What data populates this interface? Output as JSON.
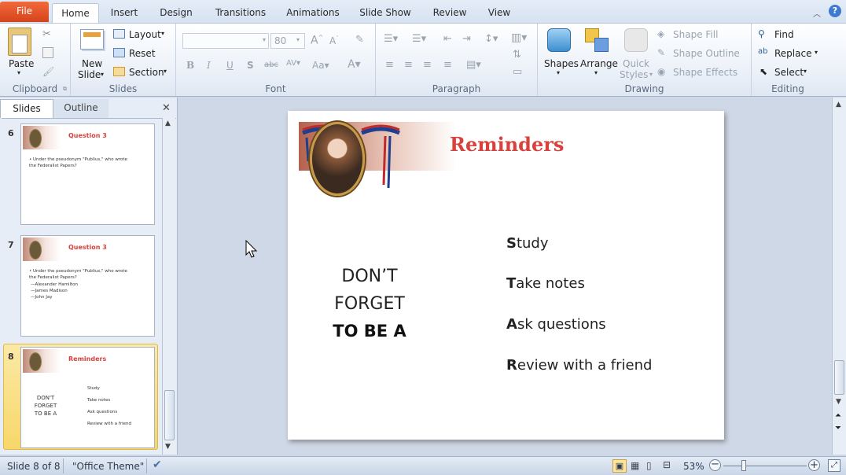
{
  "tabs": {
    "file": "File",
    "home": "Home",
    "insert": "Insert",
    "design": "Design",
    "transitions": "Transitions",
    "animations": "Animations",
    "slideshow": "Slide Show",
    "review": "Review",
    "view": "View"
  },
  "clipboard": {
    "paste": "Paste",
    "label": "Clipboard"
  },
  "slides_group": {
    "new_slide_1": "New",
    "new_slide_2": "Slide",
    "layout": "Layout",
    "reset": "Reset",
    "section": "Section",
    "label": "Slides"
  },
  "font": {
    "size": "80",
    "label": "Font"
  },
  "paragraph": {
    "label": "Paragraph"
  },
  "drawing": {
    "shapes": "Shapes",
    "arrange": "Arrange",
    "quick_1": "Quick",
    "quick_2": "Styles",
    "shape_fill": "Shape Fill",
    "shape_outline": "Shape Outline",
    "shape_effects": "Shape Effects",
    "label": "Drawing"
  },
  "editing": {
    "find": "Find",
    "replace": "Replace",
    "select": "Select",
    "label": "Editing"
  },
  "pane": {
    "slides_tab": "Slides",
    "outline_tab": "Outline"
  },
  "thumbs": [
    {
      "num": "6",
      "title": "Question 3",
      "lines": [
        "•  Under the pseudonym \"Publius,\" who wrote",
        "    the Federalist Papers?"
      ]
    },
    {
      "num": "7",
      "title": "Question 3",
      "lines": [
        "•  Under the pseudonym \"Publius,\" who wrote",
        "    the Federalist Papers?",
        "   —Alexander Hamilton",
        "   —James Madison",
        "   —John Jay"
      ]
    },
    {
      "num": "8",
      "title": "Reminders",
      "left": [
        "DON'T",
        "FORGET",
        "TO BE A"
      ],
      "right": [
        "Study",
        "Take notes",
        "Ask questions",
        "Review with a friend"
      ]
    }
  ],
  "slide": {
    "title": "Reminders",
    "left": {
      "line1": "DON’T",
      "line2": "FORGET",
      "line3": "TO BE A"
    },
    "items": [
      {
        "initial": "S",
        "rest": "tudy"
      },
      {
        "initial": "T",
        "rest": "ake notes"
      },
      {
        "initial": "A",
        "rest": "sk questions"
      },
      {
        "initial": "R",
        "rest": "eview with a friend"
      }
    ]
  },
  "status": {
    "slide_of": "Slide 8 of 8",
    "theme": "\"Office Theme\"",
    "zoom": "53%"
  },
  "colors": {
    "accent_red": "#d9413c",
    "file_tab": "#e0522a"
  }
}
